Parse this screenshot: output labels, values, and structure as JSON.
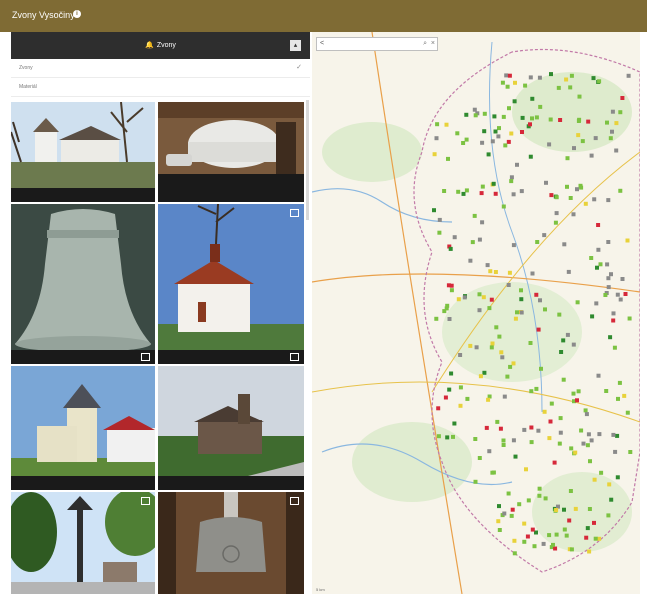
{
  "app": {
    "title": "Zvony Vysočiny",
    "info_glyph": "i"
  },
  "panel": {
    "title": "Zvony",
    "bell_glyph": "🔔",
    "collapse_glyph": "▴",
    "menu": [
      {
        "label": "Zvony",
        "selected": true,
        "check_glyph": "✓"
      },
      {
        "label": "Materiál",
        "selected": false,
        "check_glyph": ""
      }
    ]
  },
  "gallery": {
    "photos": [
      {
        "subject": "chapel-with-tree"
      },
      {
        "subject": "bell-interior"
      },
      {
        "subject": "bell-closeup"
      },
      {
        "subject": "chapel-white"
      },
      {
        "subject": "chapel-with-tower"
      },
      {
        "subject": "church-on-road"
      },
      {
        "subject": "bell-tower-post"
      },
      {
        "subject": "bell-in-belfry"
      }
    ]
  },
  "map": {
    "search_placeholder": "",
    "back_glyph": "<",
    "search_glyph": "⌕",
    "close_glyph": "×",
    "scale_label": "5 km",
    "colors": {
      "green": "#7cc242",
      "darkgreen": "#2f8a2f",
      "gray": "#8a8a8a",
      "red": "#d6283a",
      "yellow": "#e8d23a"
    }
  }
}
